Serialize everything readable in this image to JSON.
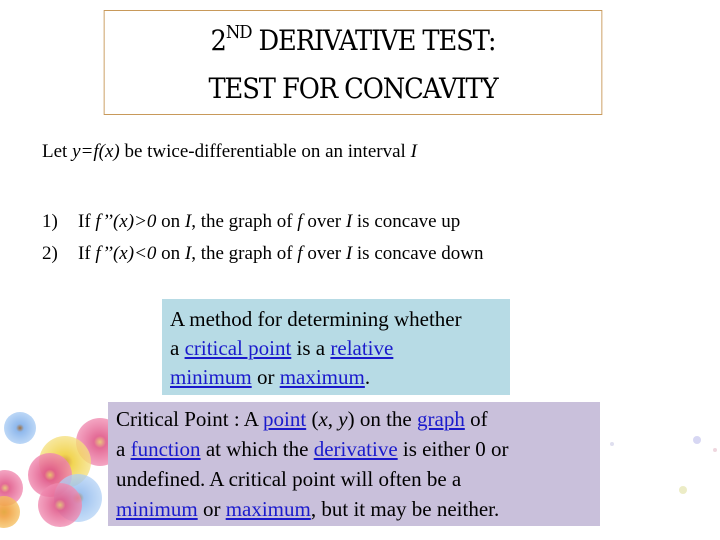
{
  "slide": {
    "title": {
      "number": "2",
      "superscript": "ND",
      "line1_rest": " DERIVATIVE TEST:",
      "line2": "TEST FOR CONCAVITY"
    },
    "intro": {
      "prefix": "Let ",
      "func": "y=f(x)",
      "middle": " be twice-differentiable on an interval ",
      "interval": "I"
    },
    "rules": [
      {
        "num": "1)",
        "if": "If ",
        "cond": "f’’(x)>0",
        "on": " on ",
        "interval": "I",
        "graph": ", the graph of ",
        "f": "f ",
        "over": " over ",
        "interval2": "I",
        "result": " is concave up"
      },
      {
        "num": "2)",
        "if": "If ",
        "cond": "f’’(x)<0",
        "on": " on ",
        "interval": "I",
        "graph": ", the graph of ",
        "f": "f ",
        "over": " over ",
        "interval2": "I",
        "result": " is concave down"
      }
    ],
    "method_box": {
      "text1": "A method for determining whether",
      "text2": "a ",
      "link_critical_point": "critical point",
      "text3": " is a ",
      "link_relative": "relative",
      "link_minimum": "minimum",
      "text4": " or ",
      "link_maximum": "maximum",
      "text5": ".",
      "background": "#b7dbe5"
    },
    "critical_box": {
      "text1": "Critical Point : A ",
      "link_point": "point",
      "text2": " (",
      "x": "x",
      "comma": ", ",
      "y": "y",
      "text3": ") on the ",
      "link_graph": "graph",
      "text4": " of",
      "text5": "a ",
      "link_function": "function",
      "text6": " at which the ",
      "link_derivative": "derivative",
      "text7": " is either 0 or",
      "text8": "undefined. A critical point will often be a",
      "link_minimum": "minimum",
      "text9": " or ",
      "link_maximum": "maximum",
      "text10": ", but it may be neither.",
      "background": "#c9c0db"
    },
    "colors": {
      "title_border": "#c8995a",
      "link": "#1a1acc"
    }
  }
}
